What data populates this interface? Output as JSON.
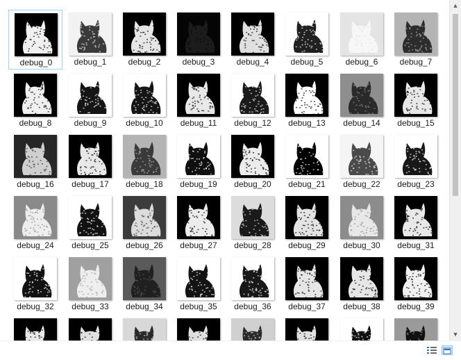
{
  "files": [
    {
      "name": "debug_0",
      "bg": "#000000",
      "fg": "#f0f0f0"
    },
    {
      "name": "debug_1",
      "bg": "#f2f2f2",
      "fg": "#3a3a3a"
    },
    {
      "name": "debug_2",
      "bg": "#000000",
      "fg": "#e6e6e6"
    },
    {
      "name": "debug_3",
      "bg": "#050505",
      "fg": "#1c1c1c"
    },
    {
      "name": "debug_4",
      "bg": "#000000",
      "fg": "#e0e0e0"
    },
    {
      "name": "debug_5",
      "bg": "#ffffff",
      "fg": "#202020"
    },
    {
      "name": "debug_6",
      "bg": "#e4e4e4",
      "fg": "#f7f7f7"
    },
    {
      "name": "debug_7",
      "bg": "#b4b4b4",
      "fg": "#2c2c2c"
    },
    {
      "name": "debug_8",
      "bg": "#000000",
      "fg": "#f0f0f0"
    },
    {
      "name": "debug_9",
      "bg": "#ffffff",
      "fg": "#151515"
    },
    {
      "name": "debug_10",
      "bg": "#ffffff",
      "fg": "#151515"
    },
    {
      "name": "debug_11",
      "bg": "#000000",
      "fg": "#e8e8e8"
    },
    {
      "name": "debug_12",
      "bg": "#ffffff",
      "fg": "#1a1a1a"
    },
    {
      "name": "debug_13",
      "bg": "#000000",
      "fg": "#ffffff"
    },
    {
      "name": "debug_14",
      "bg": "#8e8e8e",
      "fg": "#2a2a2a"
    },
    {
      "name": "debug_15",
      "bg": "#000000",
      "fg": "#e8e8e8"
    },
    {
      "name": "debug_16",
      "bg": "#262626",
      "fg": "#cfcfcf"
    },
    {
      "name": "debug_17",
      "bg": "#000000",
      "fg": "#e8e8e8"
    },
    {
      "name": "debug_18",
      "bg": "#b4b4b4",
      "fg": "#3a3a3a"
    },
    {
      "name": "debug_19",
      "bg": "#ffffff",
      "fg": "#101010"
    },
    {
      "name": "debug_20",
      "bg": "#000000",
      "fg": "#ececec"
    },
    {
      "name": "debug_21",
      "bg": "#ffffff",
      "fg": "#000000"
    },
    {
      "name": "debug_22",
      "bg": "#f5f5f5",
      "fg": "#4a4a4a"
    },
    {
      "name": "debug_23",
      "bg": "#ffffff",
      "fg": "#181818"
    },
    {
      "name": "debug_24",
      "bg": "#8a8a8a",
      "fg": "#eeeeee"
    },
    {
      "name": "debug_25",
      "bg": "#ffffff",
      "fg": "#121212"
    },
    {
      "name": "debug_26",
      "bg": "#3c3c3c",
      "fg": "#dcdcdc"
    },
    {
      "name": "debug_27",
      "bg": "#000000",
      "fg": "#ececec"
    },
    {
      "name": "debug_28",
      "bg": "#dcdcdc",
      "fg": "#1a1a1a"
    },
    {
      "name": "debug_29",
      "bg": "#000000",
      "fg": "#e4e4e4"
    },
    {
      "name": "debug_30",
      "bg": "#8c8c8c",
      "fg": "#e8e8e8"
    },
    {
      "name": "debug_31",
      "bg": "#000000",
      "fg": "#e8e8e8"
    },
    {
      "name": "debug_32",
      "bg": "#ffffff",
      "fg": "#121212"
    },
    {
      "name": "debug_33",
      "bg": "#a0a0a0",
      "fg": "#eeeeee"
    },
    {
      "name": "debug_34",
      "bg": "#5a5a5a",
      "fg": "#202020"
    },
    {
      "name": "debug_35",
      "bg": "#ffffff",
      "fg": "#141414"
    },
    {
      "name": "debug_36",
      "bg": "#ffffff",
      "fg": "#181818"
    },
    {
      "name": "debug_37",
      "bg": "#000000",
      "fg": "#e6e6e6"
    },
    {
      "name": "debug_38",
      "bg": "#000000",
      "fg": "#e6e6e6"
    },
    {
      "name": "debug_39",
      "bg": "#000000",
      "fg": "#f0f0f0"
    }
  ],
  "partial_row": [
    {
      "bg": "#000000",
      "fg": "#e8e8e8"
    },
    {
      "bg": "#000000",
      "fg": "#e0e0e0"
    },
    {
      "bg": "#d8d8d8",
      "fg": "#2a2a2a"
    },
    {
      "bg": "#000000",
      "fg": "#e0e0e0"
    },
    {
      "bg": "#d0d0d0",
      "fg": "#2a2a2a"
    },
    {
      "bg": "#000000",
      "fg": "#e0e0e0"
    },
    {
      "bg": "#ffffff",
      "fg": "#111111"
    },
    {
      "bg": "#9a9a9a",
      "fg": "#111111"
    }
  ],
  "selected_index": 0,
  "icons": {
    "details_view": "details-view-icon",
    "large_icons_view": "large-icons-view-icon"
  }
}
